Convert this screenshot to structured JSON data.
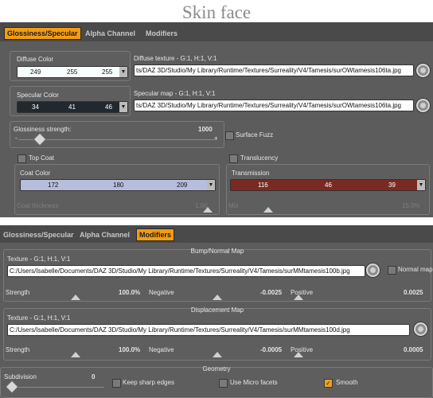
{
  "title": "Skin face",
  "top_panel": {
    "tabs": [
      "Glossiness/Specular",
      "Alpha Channel",
      "Modifiers"
    ],
    "diffuse": {
      "label": "Diffuse Color",
      "r": "249",
      "g": "255",
      "b": "255"
    },
    "diffuse_texture": {
      "label": "Diffuse texture - G:1, H:1, V:1",
      "path": "ts/DAZ 3D/Studio/My Library/Runtime/Textures/Surreality/V4/Tamesis/surOWtamesis106ta.jpg"
    },
    "specular": {
      "label": "Specular Color",
      "r": "34",
      "g": "41",
      "b": "46"
    },
    "specular_map": {
      "label": "Specular map - G:1, H:1, V:1",
      "path": "ts/DAZ 3D/Studio/My Library/Runtime/Textures/Surreality/V4/Tamesis/surOWtamesis106ta.jpg"
    },
    "glossiness": {
      "label": "Glossiness strength:",
      "value": "1000",
      "min": "-",
      "max": "+"
    },
    "surface_fuzz": "Surface Fuzz",
    "top_coat": "Top Coat",
    "translucency": "Translucency",
    "coat_color": {
      "label": "Coat Color",
      "r": "172",
      "g": "180",
      "b": "209"
    },
    "transmission": {
      "label": "Transmission",
      "r": "116",
      "g": "46",
      "b": "39"
    },
    "coat_thickness": {
      "label": "Coat thickness",
      "value": "1.00"
    },
    "mix": {
      "label": "Mix",
      "value": "15.0%"
    }
  },
  "bottom_panel": {
    "tabs": [
      "Glossiness/Specular",
      "Alpha Channel",
      "Modifiers"
    ],
    "bump": {
      "header": "Bump/Normal Map",
      "texture_label": "Texture - G:1, H:1, V:1",
      "path": "C:/Users/Isabelle/Documents/DAZ 3D/Studio/My Library/Runtime/Textures/Surreality/V4/Tamesis/surMMtamesis100b.jpg",
      "normal_map": "Normal map",
      "strength_label": "Strength",
      "strength": "100.0%",
      "negative_label": "Negative",
      "negative": "-0.0025",
      "positive_label": "Positive",
      "positive": "0.0025"
    },
    "displacement": {
      "header": "Displacement Map",
      "texture_label": "Texture - G:1, H:1, V:1",
      "path": "C:/Users/Isabelle/Documents/DAZ 3D/Studio/My Library/Runtime/Textures/Surreality/V4/Tamesis/surMMtamesis100d.jpg",
      "strength_label": "Strength",
      "strength": "100.0%",
      "negative_label": "Negative",
      "negative": "-0.0005",
      "positive_label": "Positive",
      "positive": "0.0005"
    },
    "geometry": {
      "header": "Geometry",
      "subdivision_label": "Subdivision",
      "subdivision": "0",
      "keep_sharp": "Keep sharp edges",
      "micro_facets": "Use Micro facets",
      "smooth": "Smooth",
      "smooth_checked": true
    }
  },
  "colors": {
    "accent": "#f39c12",
    "panel": "#5c5c5c",
    "coat": "#b6bedc",
    "transmission": "#7a2a22"
  }
}
